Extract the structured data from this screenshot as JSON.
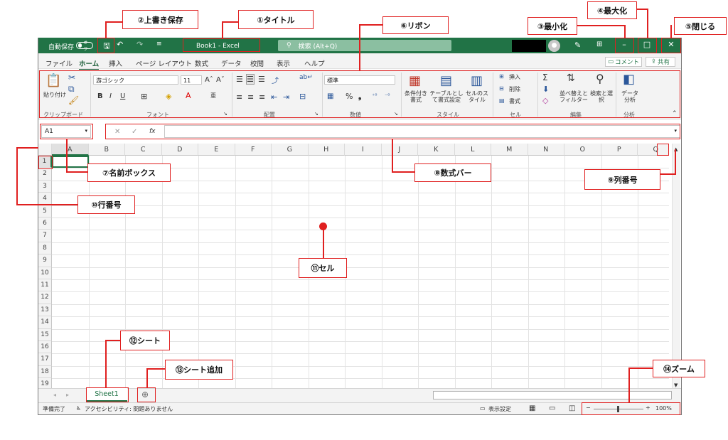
{
  "titlebar": {
    "autosave_label": "自動保存",
    "autosave_state": "オフ",
    "title": "Book1  -  Excel",
    "search_placeholder": "検索 (Alt+Q)",
    "min_glyph": "–",
    "max_glyph": "□",
    "close_glyph": "✕",
    "brand_color": "#217346"
  },
  "menu": {
    "items": [
      "ファイル",
      "ホーム",
      "挿入",
      "ページ レイアウト",
      "数式",
      "データ",
      "校閲",
      "表示",
      "ヘルプ"
    ],
    "active": "ホーム",
    "comment_label": "コメント",
    "share_label": "共有"
  },
  "ribbon": {
    "clipboard": {
      "paste": "貼り付け",
      "group": "クリップボード"
    },
    "font": {
      "name": "游ゴシック",
      "size": "11",
      "group": "フォント"
    },
    "alignment": {
      "group": "配置"
    },
    "number": {
      "format": "標準",
      "group": "数値"
    },
    "styles": {
      "conditional": "条件付き書式",
      "table": "テーブルとして書式設定",
      "cell_style": "セルのスタイル",
      "group": "スタイル"
    },
    "cells": {
      "insert": "挿入",
      "delete": "削除",
      "format": "書式",
      "group": "セル"
    },
    "editing": {
      "sort": "並べ替えとフィルター",
      "find": "検索と選択",
      "group": "編集"
    },
    "analysis": {
      "data": "データ分析",
      "group": "分析"
    }
  },
  "formula": {
    "name_box": "A1",
    "fx": "fx"
  },
  "grid": {
    "columns": [
      "A",
      "B",
      "C",
      "D",
      "E",
      "F",
      "G",
      "H",
      "I",
      "J",
      "K",
      "L",
      "M",
      "N",
      "O",
      "P",
      "Q"
    ],
    "rows": [
      "1",
      "2",
      "3",
      "4",
      "5",
      "6",
      "7",
      "8",
      "9",
      "10",
      "11",
      "12",
      "13",
      "14",
      "15",
      "16",
      "17",
      "18",
      "19"
    ]
  },
  "sheetbar": {
    "tab": "Sheet1",
    "add": "⊕"
  },
  "status": {
    "ready": "準備完了",
    "accessibility": "アクセシビリティ: 問題ありません",
    "display_settings": "表示設定",
    "zoom": "100%"
  },
  "callouts": {
    "c1": "①タイトル",
    "c2": "②上書き保存",
    "c3": "③最小化",
    "c4": "④最大化",
    "c5": "⑤閉じる",
    "c6": "⑥リボン",
    "c7": "⑦名前ボックス",
    "c8": "⑧数式バー",
    "c9": "⑨列番号",
    "c10": "⑩行番号",
    "c11": "⑪セル",
    "c12": "⑫シート",
    "c13": "⑬シート追加",
    "c14": "⑭ズーム"
  },
  "annotation_color": "#e02020"
}
